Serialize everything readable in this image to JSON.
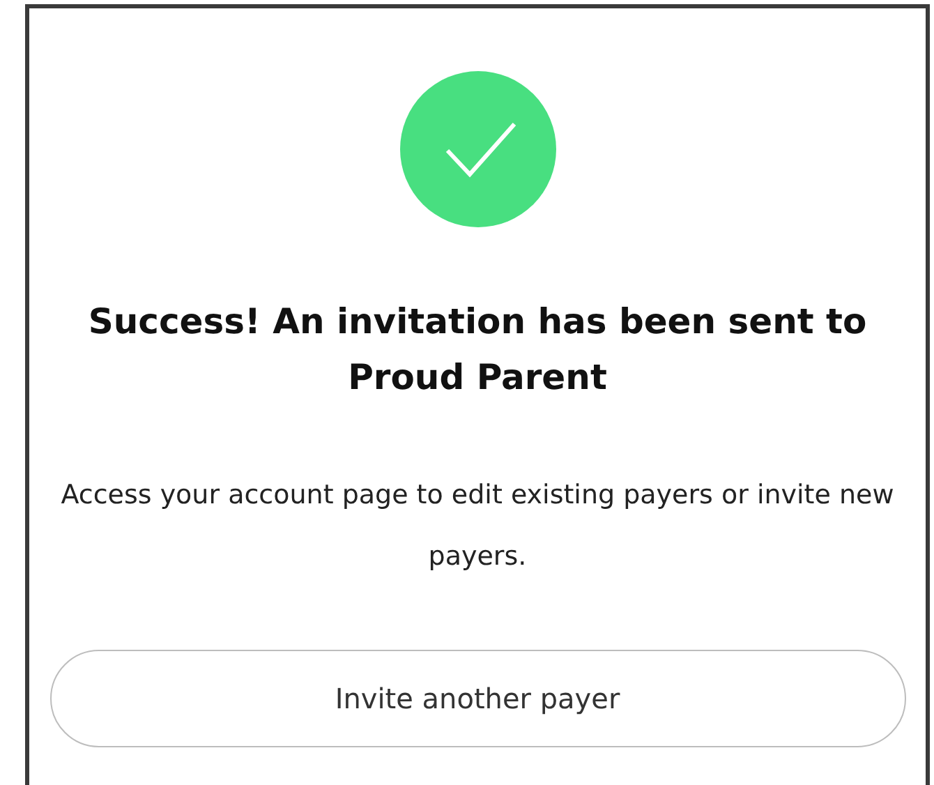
{
  "title": "Success! An invitation has been sent to Proud Parent",
  "message": "Access your account page to edit existing payers or invite new payers.",
  "button": {
    "label": "Invite another payer"
  }
}
